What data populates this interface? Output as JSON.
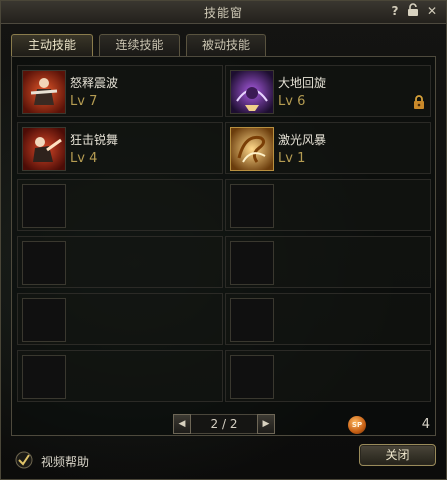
{
  "window": {
    "title": "技能窗"
  },
  "titlebar_icons": [
    "question-icon",
    "lock-open-icon",
    "close-icon"
  ],
  "tabs": [
    {
      "label": "主动技能",
      "active": true
    },
    {
      "label": "连续技能",
      "active": false
    },
    {
      "label": "被动技能",
      "active": false
    }
  ],
  "skills": [
    {
      "name": "怒释震波",
      "level": "Lv 7",
      "icon": "red-warrior-skill-icon",
      "locked": false
    },
    {
      "name": "大地回旋",
      "level": "Lv 6",
      "icon": "purple-spin-skill-icon",
      "locked": true
    },
    {
      "name": "狂击锐舞",
      "level": "Lv 4",
      "icon": "red-strike-skill-icon",
      "locked": false
    },
    {
      "name": "激光风暴",
      "level": "Lv 1",
      "icon": "golden-swirl-skill-icon",
      "locked": false
    }
  ],
  "pager": {
    "text": "2 / 2",
    "prev": "◀",
    "next": "▶"
  },
  "sp": {
    "badge": "SP",
    "value": "4"
  },
  "help": {
    "label": "视频帮助",
    "checked": true
  },
  "buttons": {
    "close": "关闭"
  }
}
